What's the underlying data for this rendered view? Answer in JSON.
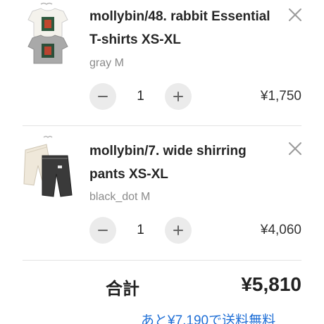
{
  "cart": {
    "items": [
      {
        "title_line1": "mollybin/48. rabbit Essential",
        "title_line2": "T-shirts XS-XL",
        "variant": "gray M",
        "quantity": "1",
        "price": "¥1,750",
        "image_icon": "tshirt-product-image"
      },
      {
        "title_line1": "mollybin/7. wide shirring",
        "title_line2": "pants XS-XL",
        "variant": "black_dot M",
        "quantity": "1",
        "price": "¥4,060",
        "image_icon": "pants-product-image"
      }
    ],
    "total_label": "合計",
    "total_value": "¥5,810",
    "shipping_note": "あと¥7,190で送料無料"
  },
  "colors": {
    "accent_link": "#1f6fd6",
    "qty_button_bg": "#ebebeb",
    "variant_text": "#8a8a8a"
  }
}
